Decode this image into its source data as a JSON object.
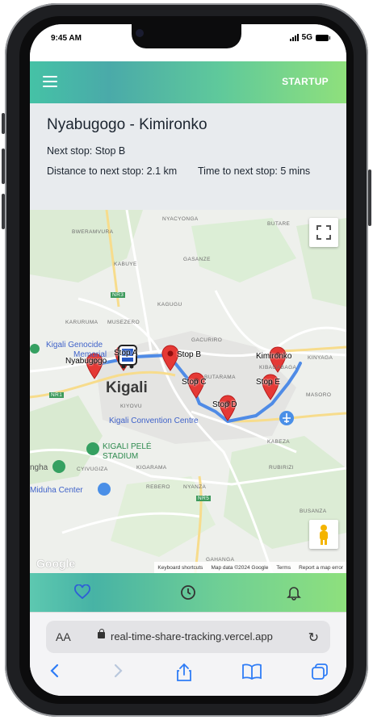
{
  "status": {
    "time": "9:45 AM",
    "network": "5G"
  },
  "header": {
    "brand": "STARTUP"
  },
  "route": {
    "title": "Nyabugogo - Kimironko",
    "next_stop": "Next stop: Stop B",
    "distance": "Distance to next stop: 2.1 km",
    "time": "Time to next stop: 5 mins"
  },
  "map": {
    "city": "Kigali",
    "area_labels": [
      "NYACYONGA",
      "BUTARE",
      "BWERAMVURA",
      "GASANZE",
      "KABUYE",
      "KAGUGU",
      "KARURUMA",
      "MUSEZERO",
      "GACURIRO",
      "KINYAGA",
      "KIBAGABAGA",
      "BUTARAMA",
      "MASORO",
      "KIYOVU",
      "KABEZA",
      "CYIVUGIZA",
      "KIGARAMA",
      "RUBIRIZI",
      "REBERO",
      "NYANZA",
      "BUSANZA",
      "GAHANGA"
    ],
    "road_labels": [
      "NR3",
      "NR1",
      "NR5"
    ],
    "pois": {
      "genocide_line1": "Kigali Genocide",
      "genocide_line2": "Memorial",
      "convention": "Kigali Convention Centre",
      "stadium_line1": "KIGALI PELÉ",
      "stadium_line2": "STADIUM",
      "left_edge": "ngha",
      "miduha": "Miduha Center"
    },
    "stops": {
      "start": "Nyabugogo",
      "a": "Stop A",
      "b": "Stop B",
      "c": "Stop C",
      "d": "Stop D",
      "e": "Stop E",
      "end": "Kimironko"
    },
    "google": "Google",
    "attribution": [
      "Keyboard shortcuts",
      "Map data ©2024 Google",
      "Terms",
      "Report a map error"
    ],
    "route_color": "#4f8be6",
    "marker_color": "#e53935"
  },
  "tabs": [
    {
      "icon": "heart-icon"
    },
    {
      "icon": "clock-icon"
    },
    {
      "icon": "bell-icon"
    }
  ],
  "browser": {
    "aa_label": "AA",
    "url": "real-time-share-tracking.vercel.app",
    "accent": "#2e7cf6"
  }
}
